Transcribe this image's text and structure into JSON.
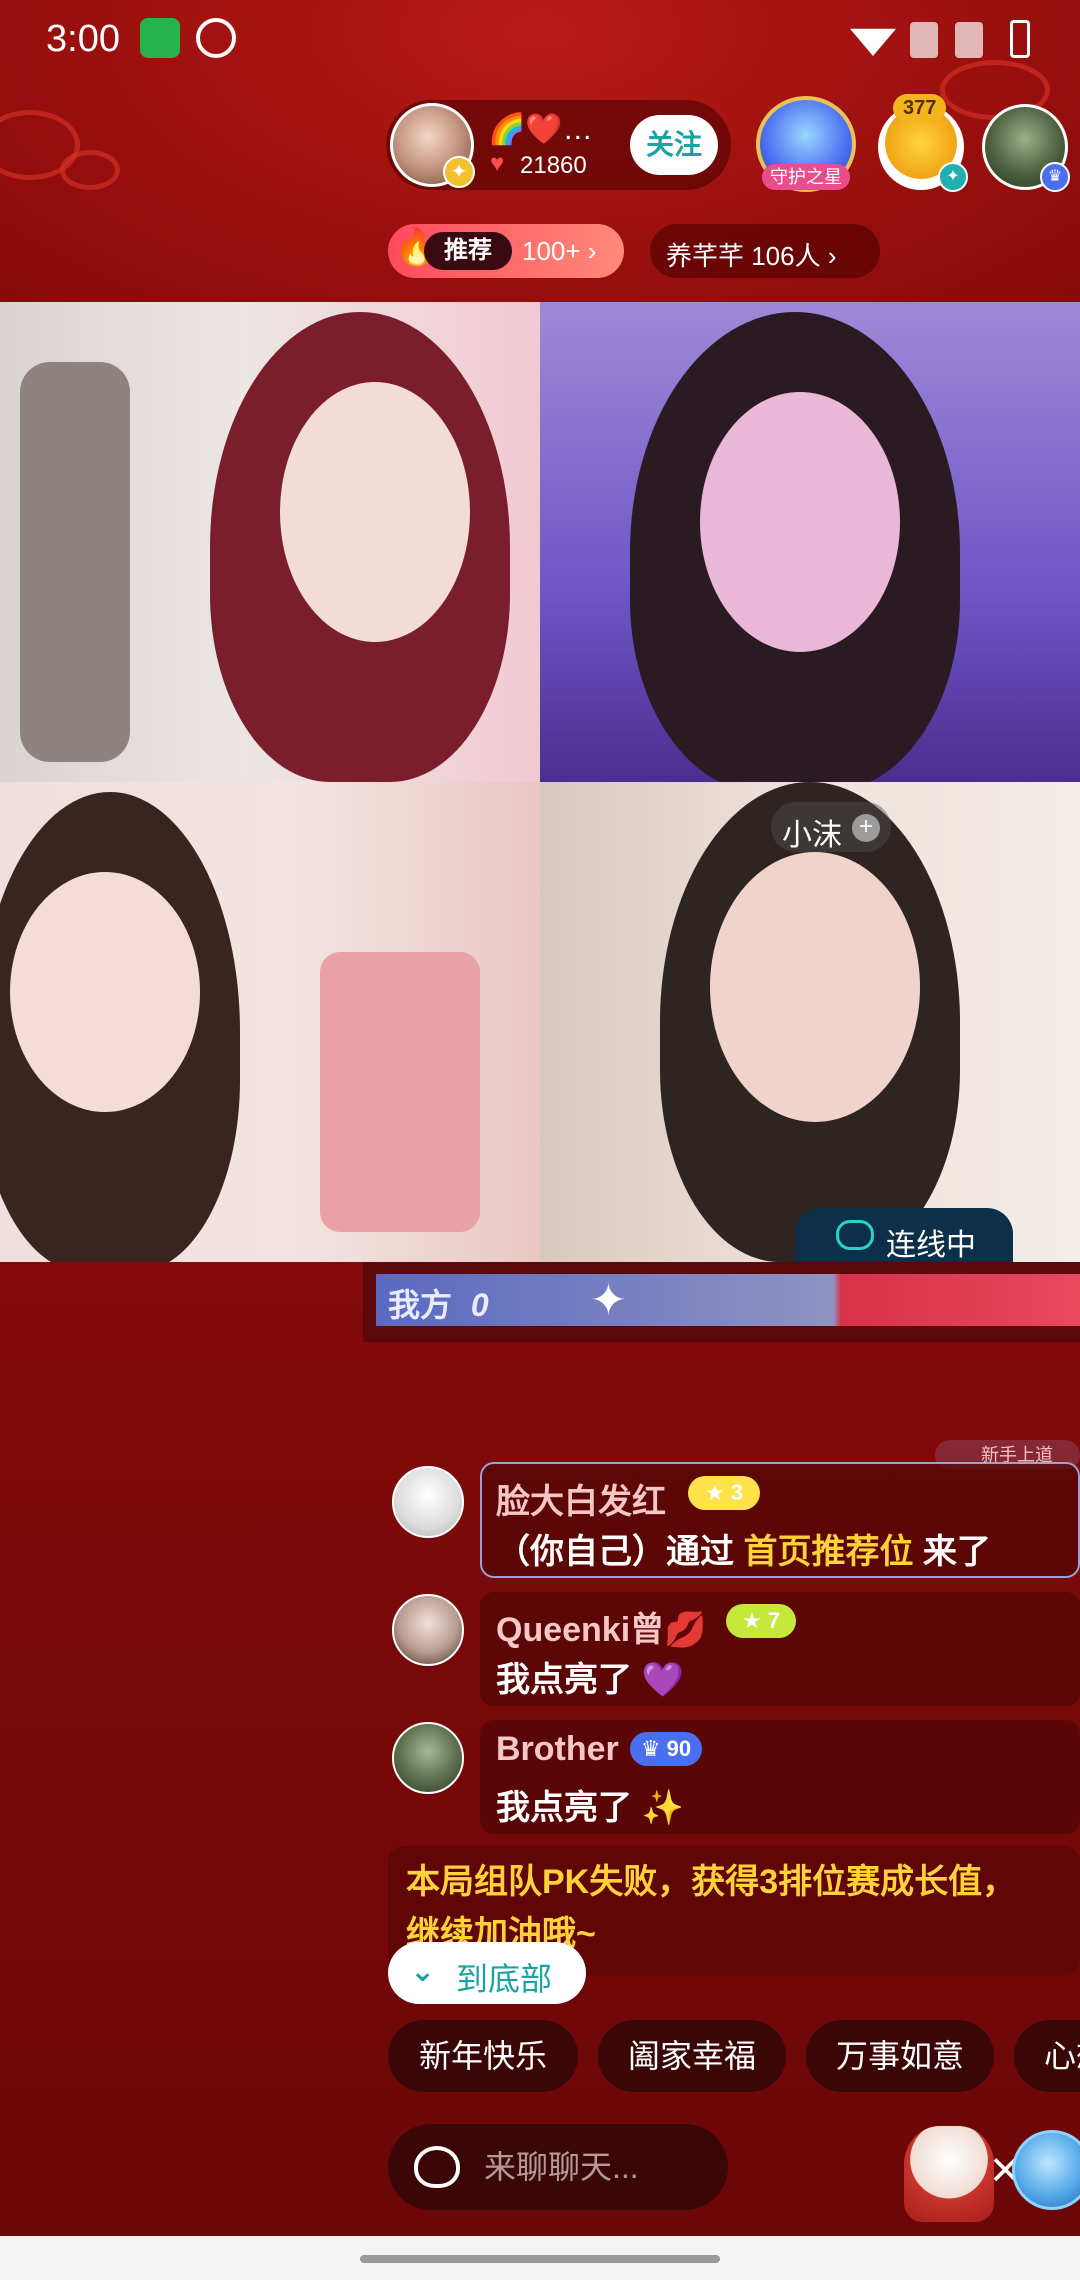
{
  "status_bar": {
    "time": "3:00"
  },
  "host": {
    "name": "🌈❤️…",
    "likes": "21860",
    "follow_label": "关注"
  },
  "guard": {
    "label": "守护之星"
  },
  "viewers": {
    "count": "377"
  },
  "recommend": {
    "tag": "推荐",
    "count": "100+ ›"
  },
  "fan_club": {
    "text": "养芊芊 106人 ›"
  },
  "video": {
    "guest_name": "小沫",
    "linking_label": "连线中"
  },
  "pk": {
    "label": "我方",
    "score": "0"
  },
  "newbie_tag": "新手上道",
  "chat": [
    {
      "name": "脸大白发红",
      "level": "★ 3",
      "message_prefix": "（你自己）通过 ",
      "message_highlight": "首页推荐位",
      "message_suffix": " 来了"
    },
    {
      "name": "Queenki曾💋",
      "level": "★ 7",
      "message": "我点亮了 💜"
    },
    {
      "name": "Brother",
      "level": "♛ 90",
      "message": "我点亮了 ✨"
    }
  ],
  "pk_notice": "本局组队PK失败，获得3排位赛成长值，继续加油哦~",
  "to_bottom": {
    "label": "到底部"
  },
  "quick_replies": [
    "新年快乐",
    "阖家幸福",
    "万事如意",
    "心想事成"
  ],
  "input": {
    "placeholder": "来聊聊天..."
  },
  "colors": {
    "accent": "#1aa3a3",
    "highlight": "#ffd23a",
    "background": "#8f0d0b"
  }
}
